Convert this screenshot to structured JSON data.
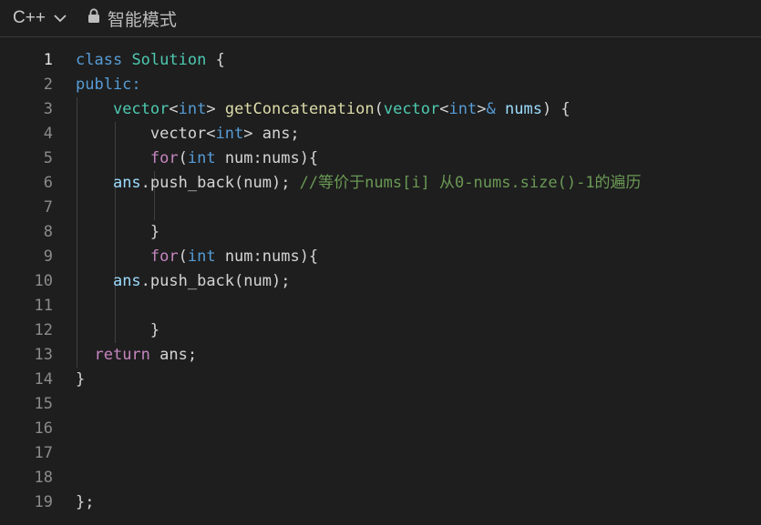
{
  "header": {
    "language": "C++",
    "language_chevron_icon": "chevron-down-icon",
    "mode_lock_icon": "lock-icon",
    "mode_label": "智能模式"
  },
  "editor": {
    "active_line": 1,
    "lines": [
      {
        "number": "1",
        "tokens": [
          {
            "t": "class",
            "c": "kw"
          },
          {
            "t": " ",
            "c": "pl"
          },
          {
            "t": "Solution",
            "c": "ty"
          },
          {
            "t": " {",
            "c": "pl"
          }
        ]
      },
      {
        "number": "2",
        "tokens": [
          {
            "t": "public:",
            "c": "kw"
          }
        ]
      },
      {
        "number": "3",
        "tokens": [
          {
            "t": "    ",
            "c": "pl"
          },
          {
            "t": "vector",
            "c": "ty"
          },
          {
            "t": "<",
            "c": "pl"
          },
          {
            "t": "int",
            "c": "kw"
          },
          {
            "t": "> ",
            "c": "pl"
          },
          {
            "t": "getConcatenation",
            "c": "fn"
          },
          {
            "t": "(",
            "c": "pl"
          },
          {
            "t": "vector",
            "c": "ty"
          },
          {
            "t": "<",
            "c": "pl"
          },
          {
            "t": "int",
            "c": "kw"
          },
          {
            "t": ">",
            "c": "pl"
          },
          {
            "t": "&",
            "c": "kw"
          },
          {
            "t": " ",
            "c": "pl"
          },
          {
            "t": "nums",
            "c": "var"
          },
          {
            "t": ") {",
            "c": "pl"
          }
        ]
      },
      {
        "number": "4",
        "tokens": [
          {
            "t": "        vector<",
            "c": "pl"
          },
          {
            "t": "int",
            "c": "kw"
          },
          {
            "t": "> ans;",
            "c": "pl"
          }
        ]
      },
      {
        "number": "5",
        "tokens": [
          {
            "t": "        ",
            "c": "pl"
          },
          {
            "t": "for",
            "c": "ctl"
          },
          {
            "t": "(",
            "c": "pl"
          },
          {
            "t": "int",
            "c": "kw"
          },
          {
            "t": " num:nums){",
            "c": "pl"
          }
        ]
      },
      {
        "number": "6",
        "tokens": [
          {
            "t": "    ",
            "c": "pl"
          },
          {
            "t": "ans",
            "c": "var"
          },
          {
            "t": ".push_back(num); ",
            "c": "pl"
          },
          {
            "t": "//等价于nums[i] 从0-nums.size()-1的遍历",
            "c": "cm"
          }
        ]
      },
      {
        "number": "7",
        "tokens": []
      },
      {
        "number": "8",
        "tokens": [
          {
            "t": "        }",
            "c": "pl"
          }
        ]
      },
      {
        "number": "9",
        "tokens": [
          {
            "t": "        ",
            "c": "pl"
          },
          {
            "t": "for",
            "c": "ctl"
          },
          {
            "t": "(",
            "c": "pl"
          },
          {
            "t": "int",
            "c": "kw"
          },
          {
            "t": " num:nums){",
            "c": "pl"
          }
        ]
      },
      {
        "number": "10",
        "tokens": [
          {
            "t": "    ",
            "c": "pl"
          },
          {
            "t": "ans",
            "c": "var"
          },
          {
            "t": ".push_back(num);",
            "c": "pl"
          }
        ]
      },
      {
        "number": "11",
        "tokens": []
      },
      {
        "number": "12",
        "tokens": [
          {
            "t": "        }",
            "c": "pl"
          }
        ]
      },
      {
        "number": "13",
        "tokens": [
          {
            "t": "  ",
            "c": "pl"
          },
          {
            "t": "return",
            "c": "ctl"
          },
          {
            "t": " ans;",
            "c": "pl"
          }
        ]
      },
      {
        "number": "14",
        "tokens": [
          {
            "t": "}",
            "c": "pl"
          }
        ]
      },
      {
        "number": "15",
        "tokens": []
      },
      {
        "number": "16",
        "tokens": []
      },
      {
        "number": "17",
        "tokens": []
      },
      {
        "number": "18",
        "tokens": []
      },
      {
        "number": "19",
        "tokens": [
          {
            "t": "};",
            "c": "pl"
          }
        ]
      }
    ]
  }
}
